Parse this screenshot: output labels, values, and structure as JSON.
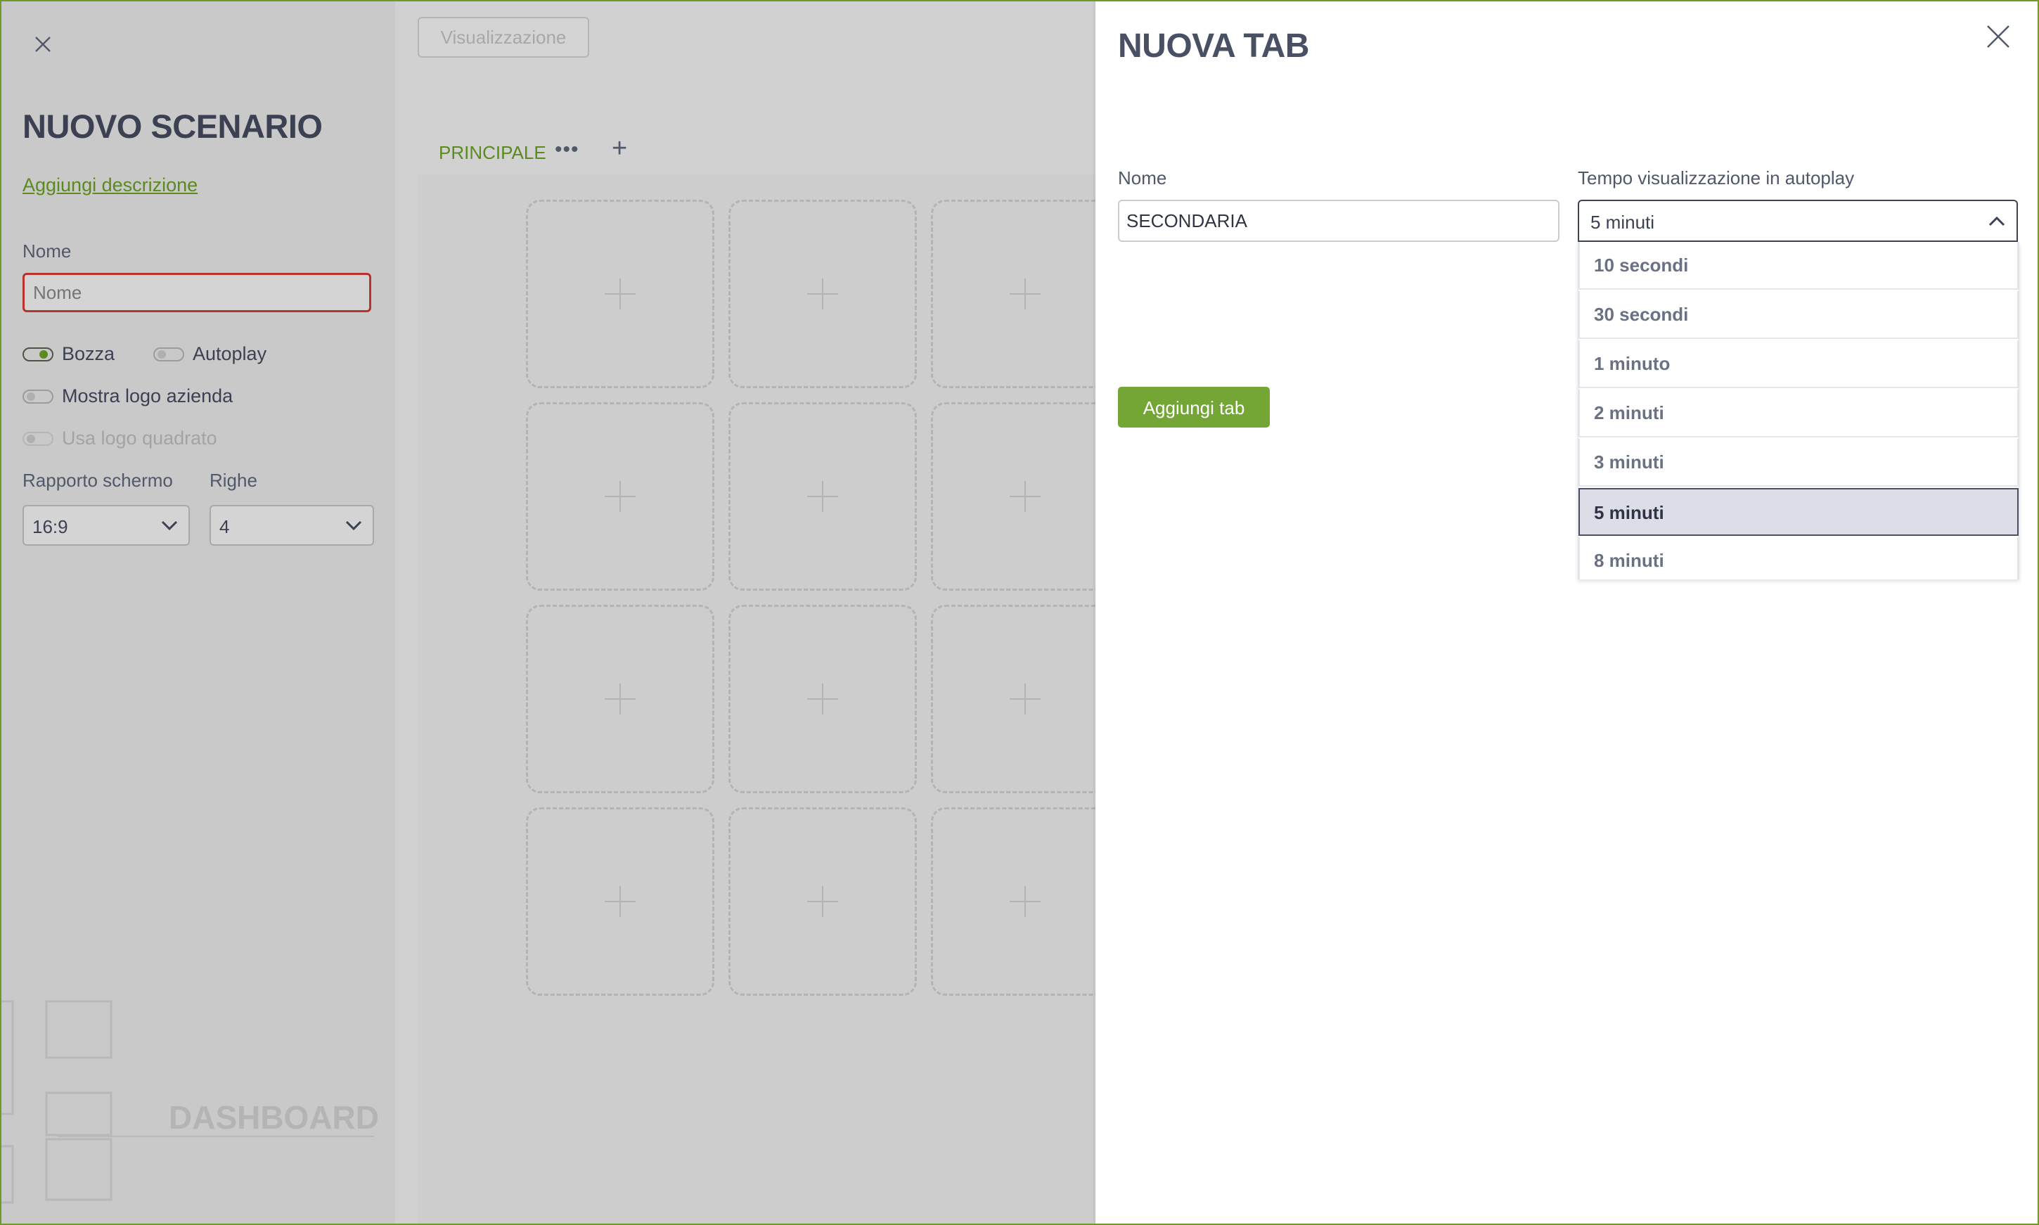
{
  "scenario": {
    "title": "NUOVO SCENARIO",
    "add_description": "Aggiungi descrizione",
    "name_label": "Nome",
    "name_placeholder": "Nome",
    "toggles": {
      "bozza": "Bozza",
      "autoplay": "Autoplay",
      "mostra_logo": "Mostra logo azienda",
      "usa_logo": "Usa logo quadrato"
    },
    "ratio_label": "Rapporto schermo",
    "ratio_value": "16:9",
    "rows_label": "Righe",
    "rows_value": "4",
    "dashboard_label": "DASHBOARD"
  },
  "editor": {
    "visualizzazione_button": "Visualizzazione",
    "tab_label": "PRINCIPALE",
    "tab_menu": "•••",
    "add_tab_symbol": "+"
  },
  "modal": {
    "title": "NUOVA TAB",
    "name_label": "Nome",
    "name_value": "SECONDARIA",
    "autoplay_label": "Tempo visualizzazione in autoplay",
    "autoplay_value": "5 minuti",
    "options": [
      "10 secondi",
      "30 secondi",
      "1 minuto",
      "2 minuti",
      "3 minuti",
      "5 minuti",
      "8 minuti"
    ],
    "selected_option": "5 minuti",
    "add_button": "Aggiungi tab"
  },
  "colors": {
    "accent": "#6e9a2c",
    "button": "#74a636",
    "error_border": "#b9322d"
  }
}
